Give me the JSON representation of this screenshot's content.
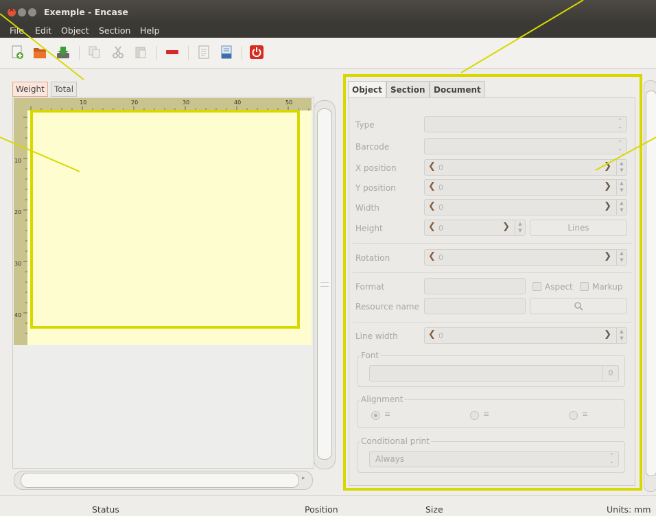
{
  "window": {
    "title": "Exemple - Encase"
  },
  "menubar": {
    "items": [
      "File",
      "Edit",
      "Object",
      "Section",
      "Help"
    ]
  },
  "toolbar": {
    "icons": [
      "new-document-icon",
      "open-folder-icon",
      "save-download-icon",
      "copy-icon",
      "cut-icon",
      "paste-icon",
      "remove-icon",
      "page-icon",
      "print-icon",
      "power-quit-icon"
    ]
  },
  "left_tabs": [
    "Weight",
    "Total"
  ],
  "ruler": {
    "top": [
      "10",
      "20",
      "30",
      "40",
      "50"
    ],
    "left": [
      "10",
      "20",
      "30",
      "40"
    ]
  },
  "right_tabs": [
    "Object",
    "Section",
    "Document"
  ],
  "form": {
    "type_label": "Type",
    "barcode_label": "Barcode",
    "xpos_label": "X position",
    "xpos_value": "0",
    "ypos_label": "Y position",
    "ypos_value": "0",
    "width_label": "Width",
    "width_value": "0",
    "height_label": "Height",
    "height_value": "0",
    "lines_button": "Lines",
    "rotation_label": "Rotation",
    "rotation_value": "0",
    "format_label": "Format",
    "aspect_label": "Aspect",
    "markup_label": "Markup",
    "resource_label": "Resource name",
    "linewidth_label": "Line width",
    "linewidth_value": "0",
    "font_group": "Font",
    "font_size": "0",
    "alignment_group": "Alignment",
    "conditional_group": "Conditional print",
    "conditional_value": "Always"
  },
  "status": {
    "status": "Status",
    "position": "Position",
    "size": "Size",
    "units": "Units: mm"
  },
  "colors": {
    "highlight": "#d8d800",
    "paper": "#fdfdcf",
    "ruler": "#c9c48d"
  }
}
